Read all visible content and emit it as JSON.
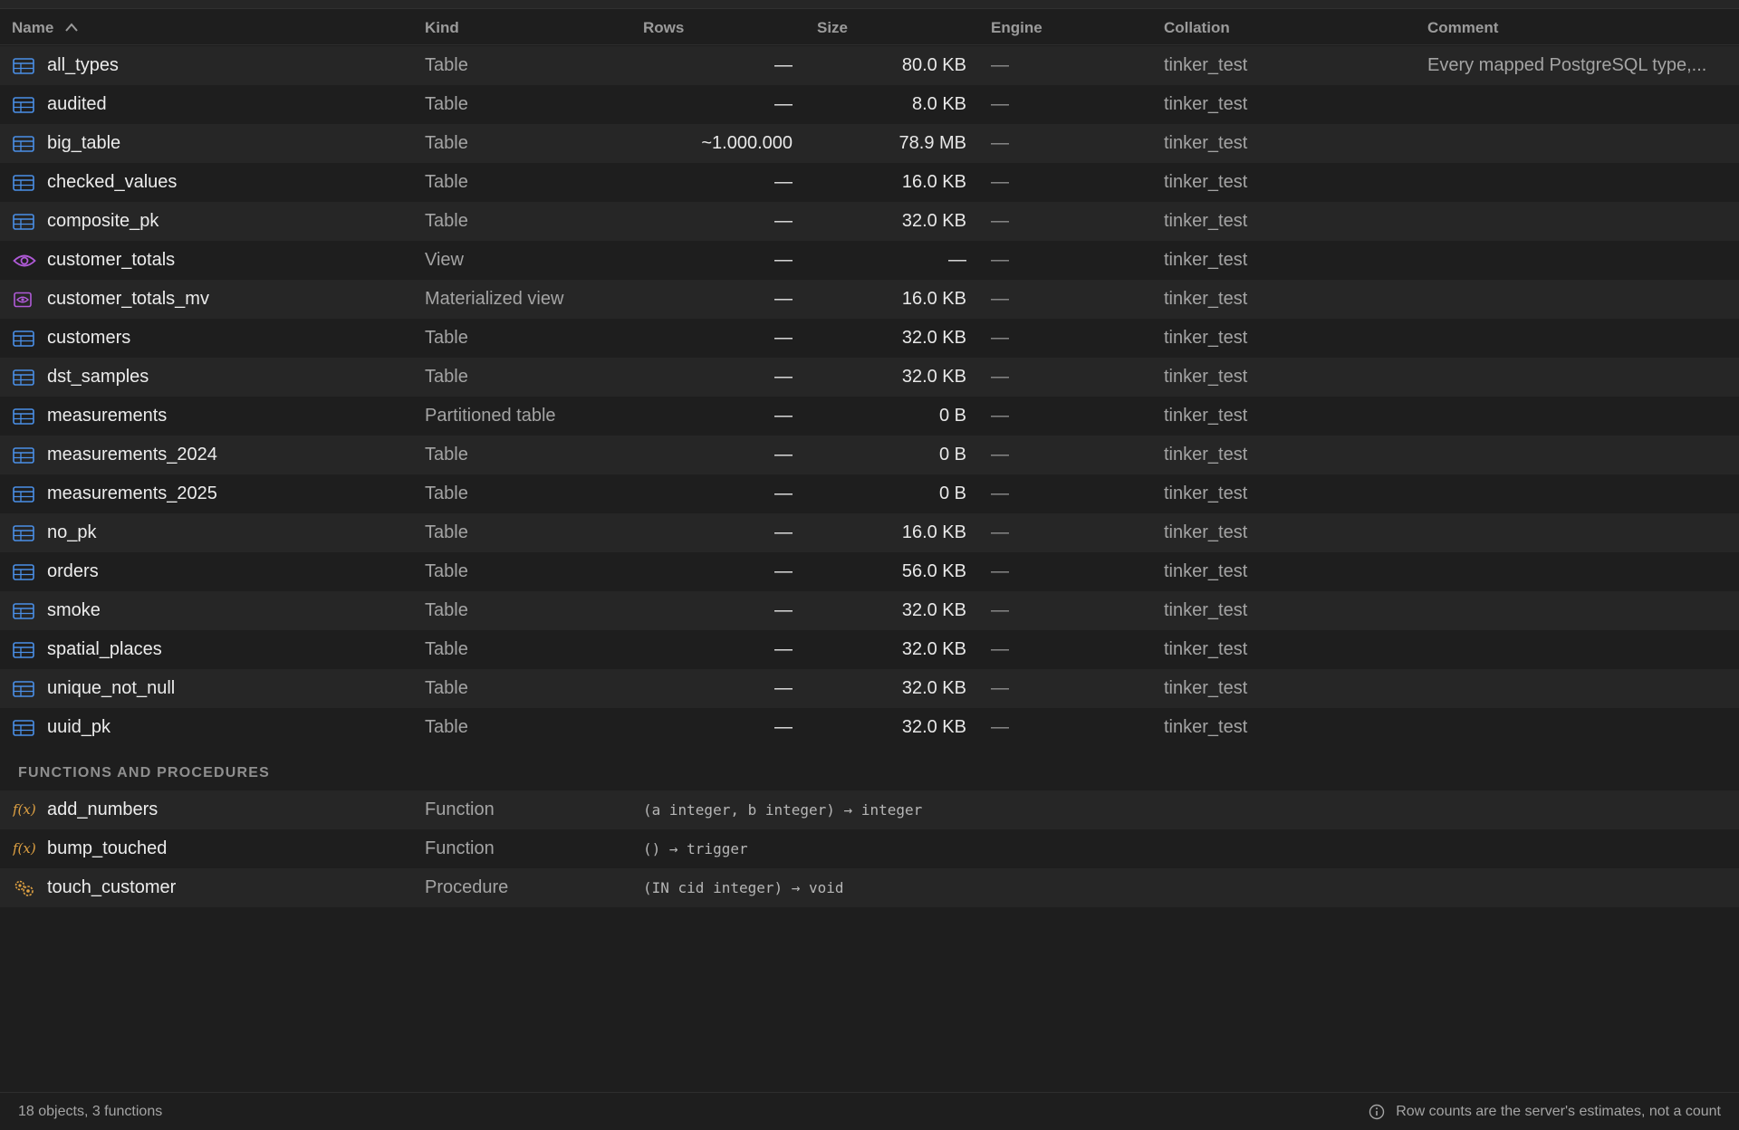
{
  "columns": {
    "name": "Name",
    "kind": "Kind",
    "rows": "Rows",
    "size": "Size",
    "engine": "Engine",
    "collation": "Collation",
    "comment": "Comment"
  },
  "colors": {
    "table_icon": "#4a8fe7",
    "view_icon": "#b05ad8",
    "function_icon": "#e0a243",
    "background": "#1e1e1e",
    "row_alt": "#262626"
  },
  "objects": [
    {
      "icon": "table-icon",
      "name": "all_types",
      "kind": "Table",
      "rows": "—",
      "size": "80.0 KB",
      "engine": "—",
      "collation": "tinker_test",
      "comment": "Every mapped PostgreSQL type,..."
    },
    {
      "icon": "table-icon",
      "name": "audited",
      "kind": "Table",
      "rows": "—",
      "size": "8.0 KB",
      "engine": "—",
      "collation": "tinker_test",
      "comment": ""
    },
    {
      "icon": "table-icon",
      "name": "big_table",
      "kind": "Table",
      "rows": "~1.000.000",
      "size": "78.9 MB",
      "engine": "—",
      "collation": "tinker_test",
      "comment": ""
    },
    {
      "icon": "table-icon",
      "name": "checked_values",
      "kind": "Table",
      "rows": "—",
      "size": "16.0 KB",
      "engine": "—",
      "collation": "tinker_test",
      "comment": ""
    },
    {
      "icon": "table-icon",
      "name": "composite_pk",
      "kind": "Table",
      "rows": "—",
      "size": "32.0 KB",
      "engine": "—",
      "collation": "tinker_test",
      "comment": ""
    },
    {
      "icon": "view-icon",
      "name": "customer_totals",
      "kind": "View",
      "rows": "—",
      "size": "—",
      "engine": "—",
      "collation": "tinker_test",
      "comment": ""
    },
    {
      "icon": "materialized-view-icon",
      "name": "customer_totals_mv",
      "kind": "Materialized view",
      "rows": "—",
      "size": "16.0 KB",
      "engine": "—",
      "collation": "tinker_test",
      "comment": ""
    },
    {
      "icon": "table-icon",
      "name": "customers",
      "kind": "Table",
      "rows": "—",
      "size": "32.0 KB",
      "engine": "—",
      "collation": "tinker_test",
      "comment": ""
    },
    {
      "icon": "table-icon",
      "name": "dst_samples",
      "kind": "Table",
      "rows": "—",
      "size": "32.0 KB",
      "engine": "—",
      "collation": "tinker_test",
      "comment": ""
    },
    {
      "icon": "table-icon",
      "name": "measurements",
      "kind": "Partitioned table",
      "rows": "—",
      "size": "0 B",
      "engine": "—",
      "collation": "tinker_test",
      "comment": ""
    },
    {
      "icon": "table-icon",
      "name": "measurements_2024",
      "kind": "Table",
      "rows": "—",
      "size": "0 B",
      "engine": "—",
      "collation": "tinker_test",
      "comment": ""
    },
    {
      "icon": "table-icon",
      "name": "measurements_2025",
      "kind": "Table",
      "rows": "—",
      "size": "0 B",
      "engine": "—",
      "collation": "tinker_test",
      "comment": ""
    },
    {
      "icon": "table-icon",
      "name": "no_pk",
      "kind": "Table",
      "rows": "—",
      "size": "16.0 KB",
      "engine": "—",
      "collation": "tinker_test",
      "comment": ""
    },
    {
      "icon": "table-icon",
      "name": "orders",
      "kind": "Table",
      "rows": "—",
      "size": "56.0 KB",
      "engine": "—",
      "collation": "tinker_test",
      "comment": ""
    },
    {
      "icon": "table-icon",
      "name": "smoke",
      "kind": "Table",
      "rows": "—",
      "size": "32.0 KB",
      "engine": "—",
      "collation": "tinker_test",
      "comment": ""
    },
    {
      "icon": "table-icon",
      "name": "spatial_places",
      "kind": "Table",
      "rows": "—",
      "size": "32.0 KB",
      "engine": "—",
      "collation": "tinker_test",
      "comment": ""
    },
    {
      "icon": "table-icon",
      "name": "unique_not_null",
      "kind": "Table",
      "rows": "—",
      "size": "32.0 KB",
      "engine": "—",
      "collation": "tinker_test",
      "comment": ""
    },
    {
      "icon": "table-icon",
      "name": "uuid_pk",
      "kind": "Table",
      "rows": "—",
      "size": "32.0 KB",
      "engine": "—",
      "collation": "tinker_test",
      "comment": ""
    }
  ],
  "functions_section": {
    "title": "FUNCTIONS AND PROCEDURES",
    "function_glyph": "f(x)",
    "items": [
      {
        "icon": "function-icon",
        "name": "add_numbers",
        "kind": "Function",
        "signature": "(a integer, b integer) → integer"
      },
      {
        "icon": "function-icon",
        "name": "bump_touched",
        "kind": "Function",
        "signature": "() → trigger"
      },
      {
        "icon": "procedure-icon",
        "name": "touch_customer",
        "kind": "Procedure",
        "signature": "(IN cid integer) → void"
      }
    ]
  },
  "footer": {
    "summary": "18 objects, 3 functions",
    "note": "Row counts are the server's estimates, not a count",
    "note_icon": "info-icon"
  }
}
